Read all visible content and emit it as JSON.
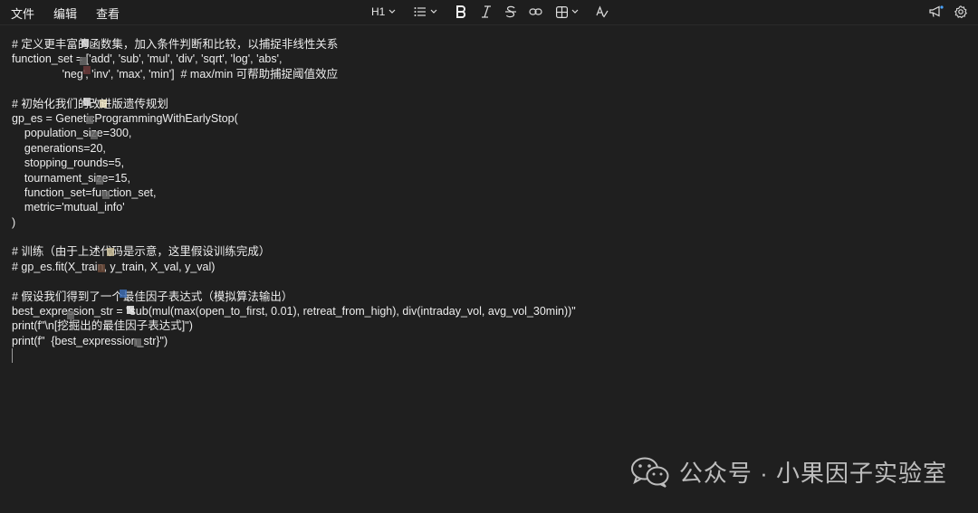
{
  "menu": {
    "file": "文件",
    "edit": "编辑",
    "view": "查看"
  },
  "toolbar": {
    "heading_label": "H1",
    "icons": [
      "list-icon",
      "bold-icon",
      "italic-icon",
      "strikethrough-icon",
      "link-icon",
      "table-icon",
      "spellcheck-icon",
      "announcement-icon",
      "settings-icon"
    ]
  },
  "code_lines": [
    "# 定义更丰富的函数集，加入条件判断和比较，以捕捉非线性关系",
    "function_set = ['add', 'sub', 'mul', 'div', 'sqrt', 'log', 'abs',",
    "                'neg', 'inv', 'max', 'min']  # max/min 可帮助捕捉阈值效应",
    "",
    "# 初始化我们的改进版遗传规划",
    "gp_es = GeneticProgrammingWithEarlyStop(",
    "    population_size=300,",
    "    generations=20,",
    "    stopping_rounds=5,",
    "    tournament_size=15,",
    "    function_set=function_set,",
    "    metric='mutual_info'",
    ")",
    "",
    "# 训练（由于上述代码是示意，这里假设训练完成）",
    "# gp_es.fit(X_train, y_train, X_val, y_val)",
    "",
    "# 假设我们得到了一个最佳因子表达式（模拟算法输出）",
    "best_expression_str = \"sub(mul(max(open_to_first, 0.01), retreat_from_high), div(intraday_vol, avg_vol_30min))\"",
    "print(f\"\\n[挖掘出的最佳因子表达式]\")",
    "print(f\"  {best_expression_str}\")"
  ],
  "watermark": {
    "text": "公众号 · 小果因子实验室"
  }
}
